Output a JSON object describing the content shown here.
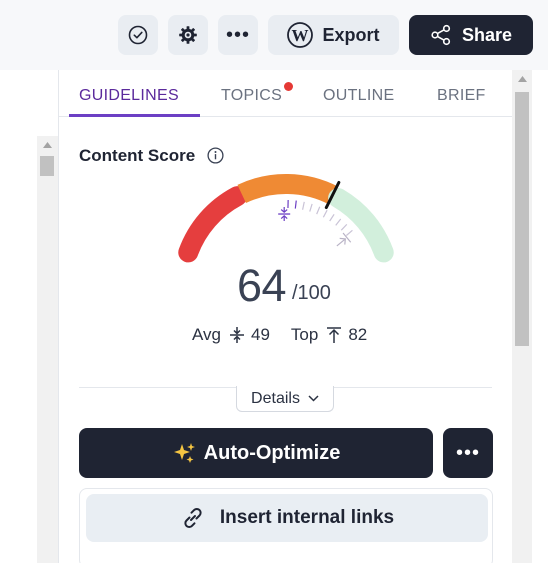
{
  "toolbar": {
    "check_icon": "check-circle-icon",
    "gear_icon": "gear-icon",
    "more_label": "•••",
    "export_label": "Export",
    "export_icon": "wordpress-icon",
    "share_label": "Share",
    "share_icon": "share-icon"
  },
  "tabs": [
    {
      "label": "GUIDELINES",
      "active": true
    },
    {
      "label": "TOPICS",
      "has_notification": true
    },
    {
      "label": "OUTLINE"
    },
    {
      "label": "BRIEF"
    }
  ],
  "content_score": {
    "title": "Content Score",
    "score": "64",
    "max": "/100",
    "avg_label": "Avg",
    "avg_value": "49",
    "top_label": "Top",
    "top_value": "82",
    "score_fraction": 0.64,
    "avg_fraction": 0.49,
    "top_fraction": 0.82
  },
  "details_label": "Details",
  "auto_optimize_label": "Auto-Optimize",
  "auto_optimize_icon": "sparkles-icon",
  "more_actions_label": "•••",
  "insert_links_label": "Insert internal links",
  "insert_links_icon": "link-icon",
  "colors": {
    "red": "#e53e3e",
    "orange": "#ef8a34",
    "green": "#d2efdc",
    "accent": "#6c3fc4",
    "dark": "#1f2433"
  }
}
